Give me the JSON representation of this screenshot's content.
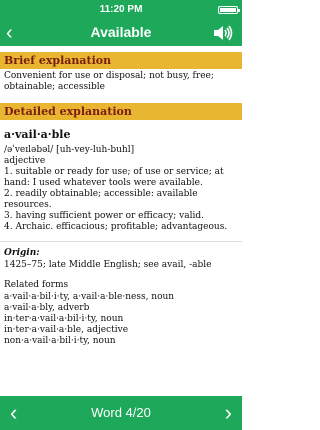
{
  "status_bar": {
    "carrier": "",
    "time": "11:20 PM"
  },
  "nav": {
    "title": "Available",
    "back_icon": "chevron-left-icon",
    "speaker_icon": "speaker-icon"
  },
  "brief": {
    "header": "Brief explanation",
    "text": "Convenient for use or disposal; not busy, free; obtainable; accessible"
  },
  "detailed": {
    "header": "Detailed explanation",
    "headword": "a·vail·a·ble",
    "pronunciation": "/əˈveɪləbəl/ [uh-vey-luh-buhl]",
    "pos": "adjective",
    "definitions": [
      "1. suitable or ready for use; of use or service; at hand: I used whatever tools were available.",
      "2. readily obtainable; accessible: available resources.",
      "3. having sufficient power or efficacy; valid.",
      "4. Archaic. efficacious; profitable; advantageous."
    ],
    "origin_label": "Origin:",
    "origin_text": "1425–75; late Middle English;  see avail, -able",
    "related_title": "Related forms",
    "related": [
      "a·vail·a·bil·i·ty, a·vail·a·ble·ness, noun",
      "a·vail·a·bly, adverb",
      "in·ter·a·vail·a·bil·i·ty, noun",
      "in·ter·a·vail·a·ble, adjective",
      "non·a·vail·a·bil·i·ty, noun"
    ]
  },
  "bottom": {
    "counter": "Word 4/20",
    "prev_icon": "chevron-left-icon",
    "next_icon": "chevron-right-icon"
  },
  "colors": {
    "bar": "#1ea85a",
    "section": "#e8b630",
    "section_text": "#7a1d10"
  }
}
